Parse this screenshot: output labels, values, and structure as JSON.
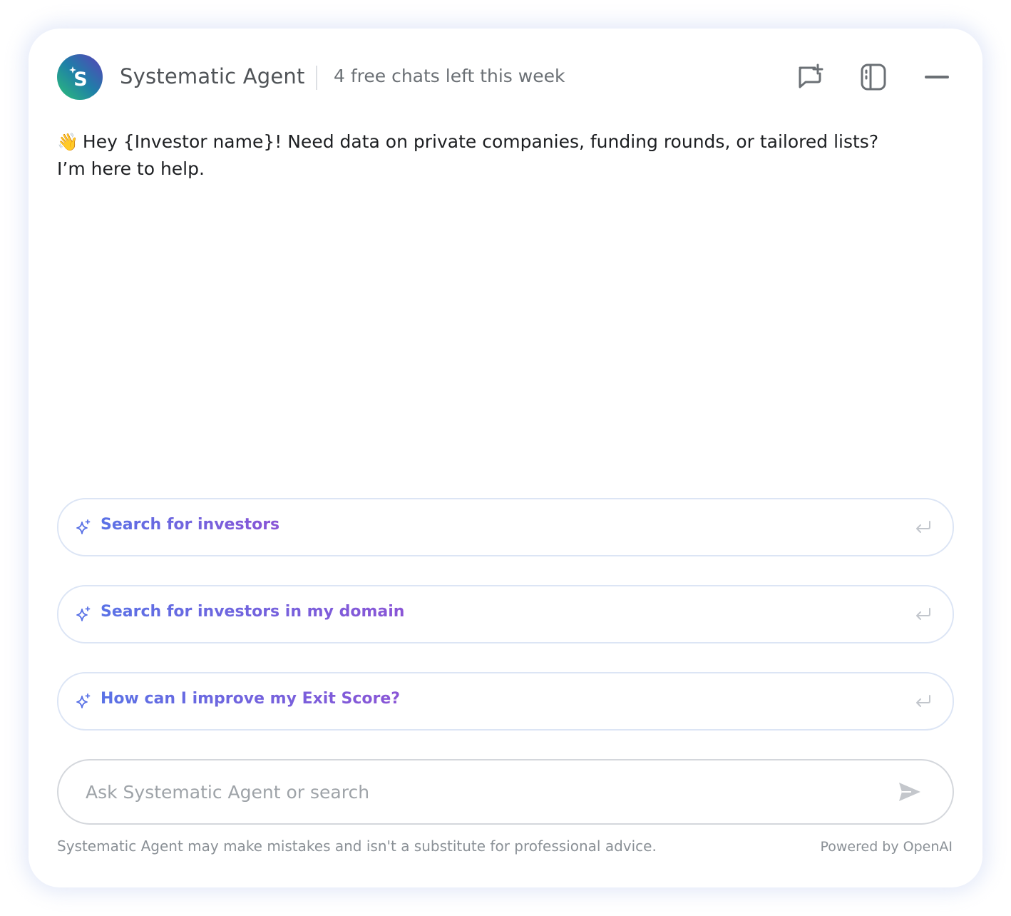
{
  "header": {
    "title": "Systematic Agent",
    "subtitle": "4 free chats left this week",
    "avatar_letter": "S",
    "buttons": {
      "new_chat_icon": "new-chat-icon",
      "sidebar_icon": "sidebar-toggle-icon",
      "minimize_icon": "minimize-icon"
    }
  },
  "greeting": {
    "emoji": "👋",
    "line1": "Hey {Investor name}! Need data on private companies, funding rounds, or tailored lists?",
    "line2": "I’m here to help."
  },
  "suggestions": [
    {
      "label": "Search for investors",
      "icon": "sparkle-icon"
    },
    {
      "label": "Search for investors in my domain",
      "icon": "sparkle-icon"
    },
    {
      "label": "How can I improve my Exit Score?",
      "icon": "sparkle-icon"
    }
  ],
  "input": {
    "placeholder": "Ask Systematic Agent or search",
    "value": ""
  },
  "footer": {
    "disclaimer": "Systematic Agent may make mistakes and isn't a substitute for professional advice.",
    "powered_by": "Powered by OpenAI"
  },
  "colors": {
    "suggestion_start": "#5a72e6",
    "suggestion_end": "#8a55d6",
    "border": "#dce5f5",
    "icon_gray": "#6b7075"
  }
}
